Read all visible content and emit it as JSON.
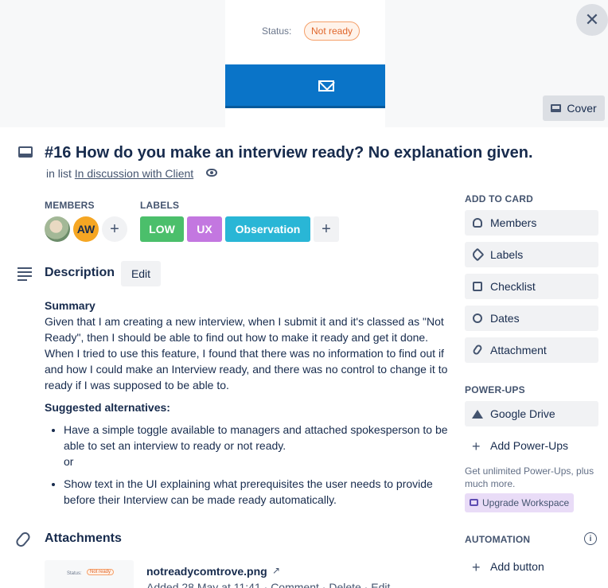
{
  "cover": {
    "status_label": "Status:",
    "status_value": "Not ready",
    "cover_button": "Cover"
  },
  "card": {
    "title": "#16 How do you make an interview ready? No explanation given.",
    "in_list_prefix": "in list",
    "list_name": "In discussion with Client"
  },
  "members": {
    "heading": "MEMBERS",
    "initials": "AW",
    "add": "+"
  },
  "labels": {
    "heading": "LABELS",
    "items": [
      {
        "text": "LOW",
        "color": "#4bbf6b"
      },
      {
        "text": "UX",
        "color": "#c377e0"
      },
      {
        "text": "Observation",
        "color": "#29b6d6"
      }
    ],
    "add": "+"
  },
  "description": {
    "heading": "Description",
    "edit": "Edit",
    "summary_heading": "Summary",
    "summary_text": "Given that I am creating a new interview, when I submit it and it's classed as \"Not Ready\", then I should be able to find out how to make it ready and get it done. When I tried to use this feature, I found that there was no information to find out if and how I could make an Interview ready, and there was no control to change it to ready if I was supposed to be able to.",
    "alternatives_heading": "Suggested alternatives:",
    "alternatives": [
      "Have a simple toggle available to managers and attached spokesperson to be able to set an interview to ready or not ready.",
      "Show text in the UI explaining what prerequisites the user needs to provide before their Interview can be made ready automatically."
    ],
    "alt_or": "or"
  },
  "attachments": {
    "heading": "Attachments",
    "thumb_status": "Status:",
    "thumb_badge": "Not ready",
    "file_name": "notreadycomtrove.png",
    "open_icon": "↗",
    "added": "Added 28 May at 11:41",
    "comment": "Comment",
    "delete": "Delete",
    "edit": "Edit"
  },
  "sidebar": {
    "add_to_card": "ADD TO CARD",
    "members": "Members",
    "labels": "Labels",
    "checklist": "Checklist",
    "dates": "Dates",
    "attachment": "Attachment",
    "power_ups": "POWER-UPS",
    "google_drive": "Google Drive",
    "add_power_ups": "Add Power-Ups",
    "note": "Get unlimited Power-Ups, plus much more.",
    "upgrade": "Upgrade Workspace",
    "automation": "AUTOMATION",
    "add_button": "Add button"
  },
  "icons": {
    "close": "close-icon",
    "cover": "cover-icon",
    "card": "card-icon",
    "watch": "eye-icon",
    "description": "description-icon",
    "attachment": "paperclip-icon"
  }
}
